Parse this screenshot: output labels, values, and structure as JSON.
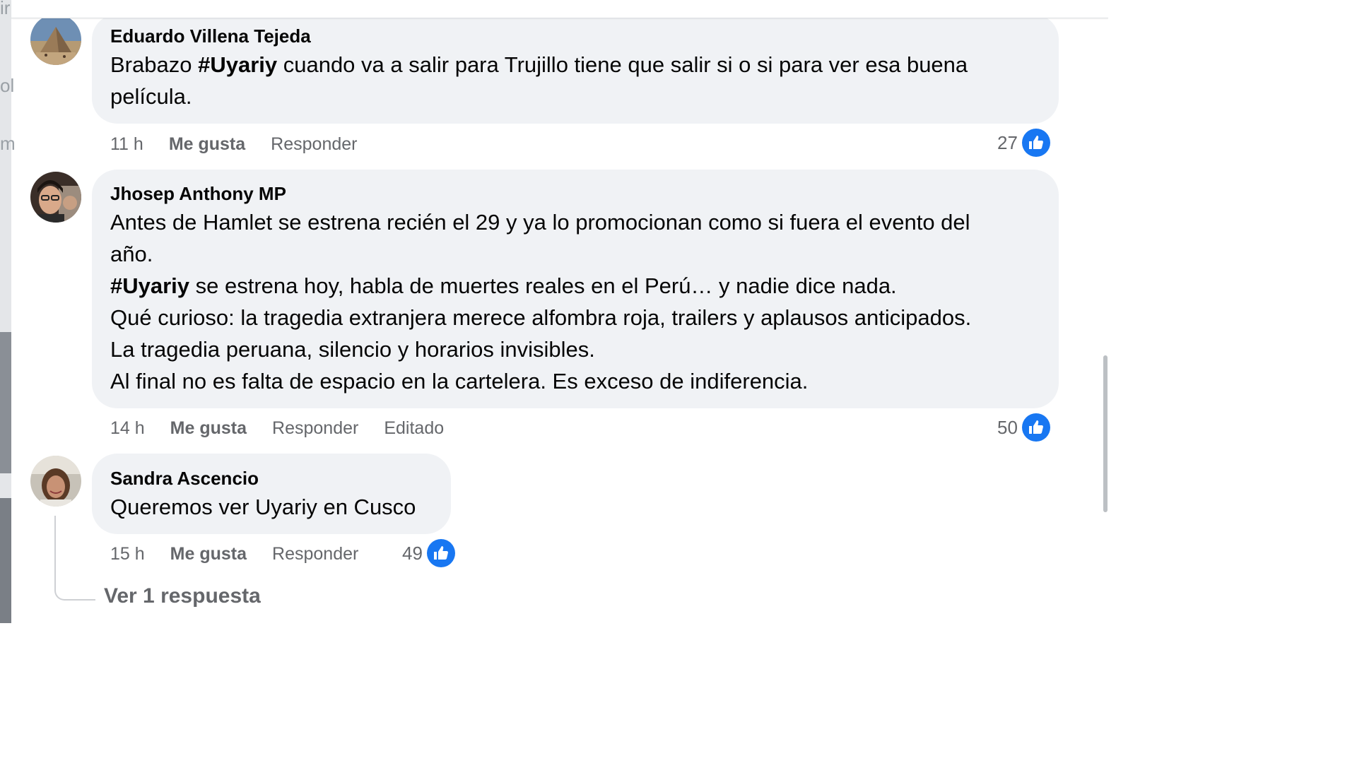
{
  "theme": {
    "bubble_bg": "#f0f2f5",
    "like_blue": "#1877f2",
    "meta_grey": "#65676b"
  },
  "backdrop": {
    "left_glyphs": [
      "ir",
      "ol",
      "m"
    ]
  },
  "comments": [
    {
      "author": "Eduardo Villena Tejeda",
      "avatar_icon": "pyramid-photo-avatar",
      "text": {
        "pre": "Brabazo ",
        "hashtag": "#Uyariy",
        "line1_rest": " cuando va a salir para Trujillo tiene que salir si o si para ver esa buena",
        "line2": "película."
      },
      "time": "11 h",
      "like_label": "Me gusta",
      "reply_label": "Responder",
      "reaction_count": "27",
      "reaction_icon": "thumbs-up-icon"
    },
    {
      "author": "Jhosep Anthony MP",
      "avatar_icon": "person-photo-avatar",
      "text": {
        "line1": "Antes de Hamlet se estrena recién el 29 y ya lo promocionan como si fuera el evento del",
        "line2": "año.",
        "line3_hashtag": "#Uyariy",
        "line3_rest": " se estrena hoy, habla de muertes reales en el Perú… y nadie dice nada.",
        "line4": "Qué curioso: la tragedia extranjera merece alfombra roja, trailers y aplausos anticipados.",
        "line5": "La tragedia peruana, silencio y horarios invisibles.",
        "line6": "Al final no es falta de espacio en la cartelera. Es exceso de indiferencia."
      },
      "time": "14 h",
      "like_label": "Me gusta",
      "reply_label": "Responder",
      "edited_label": "Editado",
      "reaction_count": "50",
      "reaction_icon": "thumbs-up-icon"
    },
    {
      "author": "Sandra Ascencio",
      "avatar_icon": "woman-photo-avatar",
      "text": {
        "line1": "Queremos ver Uyariy en Cusco"
      },
      "time": "15 h",
      "like_label": "Me gusta",
      "reply_label": "Responder",
      "reaction_count": "49",
      "reaction_icon": "thumbs-up-icon",
      "replies_link": "Ver 1 respuesta"
    }
  ]
}
